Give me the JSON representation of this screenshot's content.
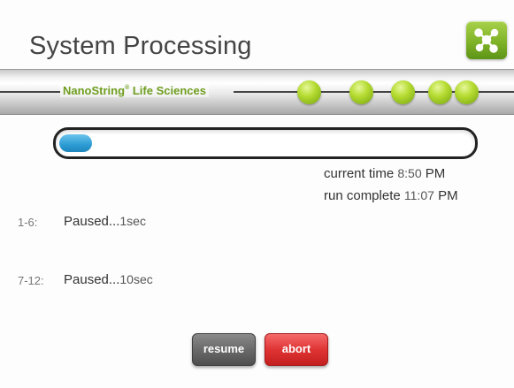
{
  "header": {
    "title": "System Processing",
    "icon": "network-nodes-icon"
  },
  "band": {
    "brand_name": "NanoString",
    "brand_mark": "®",
    "brand_suffix": " Life Sciences",
    "step_dots": 5,
    "accent": "#8ab61a"
  },
  "progress": {
    "fraction": 0.08,
    "color": "#2c9bd4"
  },
  "times": {
    "current_label": "current time",
    "current_value": "8:50",
    "current_ampm": "PM",
    "complete_label": "run complete",
    "complete_value": "11:07",
    "complete_ampm": "PM"
  },
  "lanes": [
    {
      "label": "1-6:",
      "status": "Paused...",
      "time": "1sec"
    },
    {
      "label": "7-12:",
      "status": "Paused...",
      "time": "10sec"
    }
  ],
  "buttons": {
    "resume": "resume",
    "abort": "abort"
  }
}
